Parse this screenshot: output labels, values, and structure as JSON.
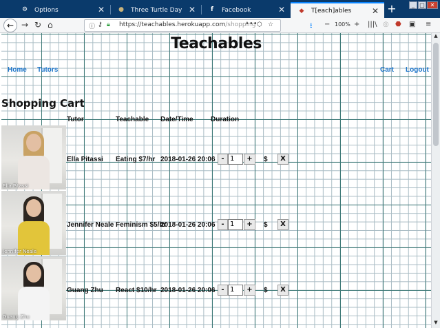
{
  "browser": {
    "tabs": [
      {
        "title": "Options",
        "icon": "gear-icon"
      },
      {
        "title": "Three Turtle Day",
        "icon": "globe-icon"
      },
      {
        "title": "Facebook",
        "icon": "facebook-icon"
      },
      {
        "title": "T[each]ables",
        "icon": "teachables-icon"
      }
    ],
    "url": {
      "host": "https://teachables.herokuapp.com",
      "path": "/shopping"
    },
    "zoom": "100%"
  },
  "site": {
    "brand": "Teachables",
    "nav_left": [
      "Home",
      "Tutors"
    ],
    "nav_right": [
      "Cart",
      "Logout"
    ]
  },
  "cart": {
    "heading": "Shopping Cart",
    "columns": {
      "tutor": "Tutor",
      "teachable": "Teachable",
      "datetime": "Date/Time",
      "duration": "Duration"
    },
    "items": [
      {
        "caption": "Ella Pitassi",
        "tutor": "Ella Pitassi",
        "teachable": "Eating $7/hr",
        "datetime": "2018-01-26 20:06",
        "minus": "-",
        "qty": "1",
        "plus": "+",
        "price": "$",
        "remove": "X"
      },
      {
        "caption": "Jennifer Neale",
        "tutor": "Jennifer Neale",
        "teachable": "Feminism $5/hr",
        "datetime": "2018-01-26 20:06",
        "minus": "-",
        "qty": "1",
        "plus": "+",
        "price": "$",
        "remove": "X"
      },
      {
        "caption": "Guang Zhu",
        "tutor": "Guang Zhu",
        "teachable": "React $10/hr",
        "datetime": "2018-01-26 20:06",
        "minus": "-",
        "qty": "1",
        "plus": "+",
        "price": "$",
        "remove": "X"
      }
    ]
  },
  "colors": {
    "link": "#1a73c8",
    "tabbar": "#0a3a6b",
    "grid_major": "#3f7a78",
    "grid_minor": "#a9bcc4"
  }
}
